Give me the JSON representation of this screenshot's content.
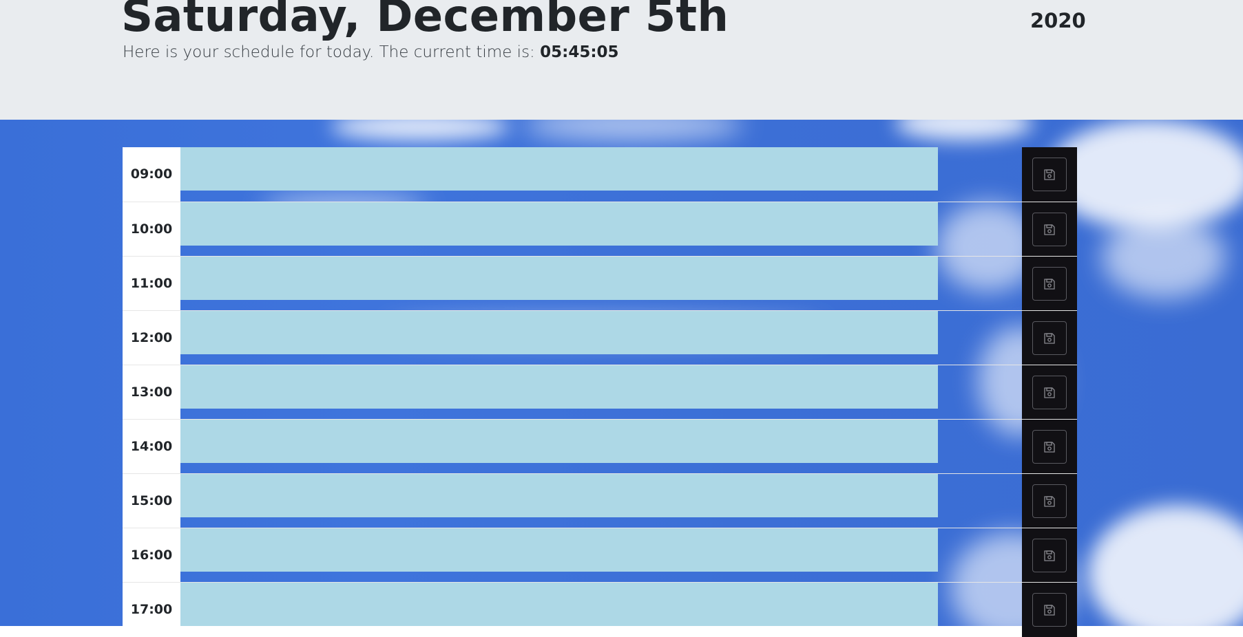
{
  "header": {
    "title": "Saturday, December 5th",
    "year": "2020",
    "lead_text": "Here is your schedule for today. The current time is: ",
    "current_time": "05:45:05"
  },
  "schedule": {
    "rows": [
      {
        "hour": "09:00",
        "value": ""
      },
      {
        "hour": "10:00",
        "value": ""
      },
      {
        "hour": "11:00",
        "value": ""
      },
      {
        "hour": "12:00",
        "value": ""
      },
      {
        "hour": "13:00",
        "value": ""
      },
      {
        "hour": "14:00",
        "value": ""
      },
      {
        "hour": "15:00",
        "value": ""
      },
      {
        "hour": "16:00",
        "value": ""
      },
      {
        "hour": "17:00",
        "value": ""
      }
    ],
    "save_icon": "floppy-disk-icon"
  },
  "colors": {
    "header_bg": "#e9ecef",
    "slot_bg": "#add8e6",
    "save_column_bg": "#111014",
    "sky": "#3f74dc"
  }
}
